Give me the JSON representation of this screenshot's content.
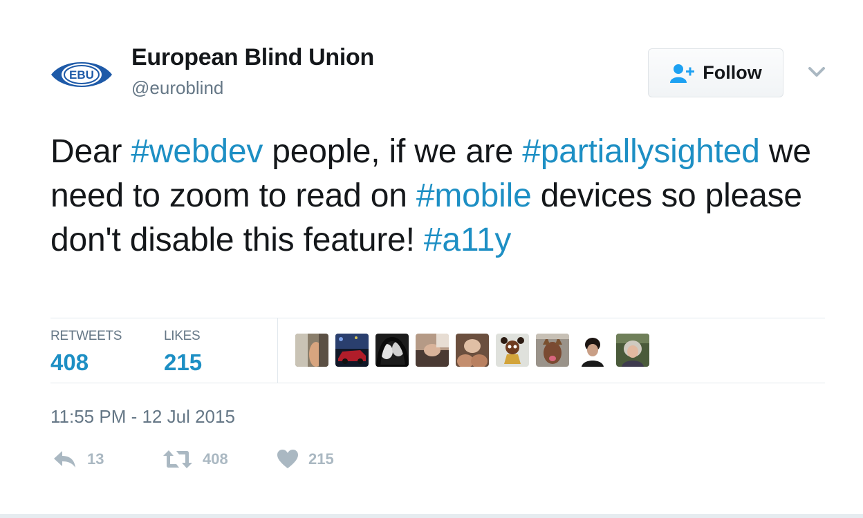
{
  "user": {
    "name": "European Blind Union",
    "handle": "@euroblind",
    "avatar_text": "EBU"
  },
  "follow_button": {
    "label": "Follow",
    "icon": "add-user-icon"
  },
  "menu": {
    "icon": "chevron-down-icon"
  },
  "tweet": {
    "segments": [
      {
        "text": "Dear ",
        "type": "text"
      },
      {
        "text": "#webdev",
        "type": "hashtag"
      },
      {
        "text": " people, if we are ",
        "type": "text"
      },
      {
        "text": "#partiallysighted",
        "type": "hashtag"
      },
      {
        "text": " we need to zoom to read on ",
        "type": "text"
      },
      {
        "text": "#mobile",
        "type": "hashtag"
      },
      {
        "text": " devices so please don't disable this feature! ",
        "type": "text"
      },
      {
        "text": "#a11y",
        "type": "hashtag"
      }
    ]
  },
  "stats": {
    "retweets_label": "RETWEETS",
    "retweets_value": "408",
    "likes_label": "LIKES",
    "likes_value": "215"
  },
  "likers": [
    {
      "icon": "avatar-1"
    },
    {
      "icon": "avatar-2"
    },
    {
      "icon": "avatar-3"
    },
    {
      "icon": "avatar-4"
    },
    {
      "icon": "avatar-5"
    },
    {
      "icon": "avatar-6"
    },
    {
      "icon": "avatar-7"
    },
    {
      "icon": "avatar-8"
    },
    {
      "icon": "avatar-9"
    }
  ],
  "timestamp": "11:55 PM - 12 Jul 2015",
  "actions": {
    "reply_count": "13",
    "retweet_count": "408",
    "like_count": "215"
  },
  "colors": {
    "hashtag": "#1d8fc4",
    "brand": "#1e5aa8",
    "muted": "#657786",
    "action_icon": "#aab8c2"
  }
}
